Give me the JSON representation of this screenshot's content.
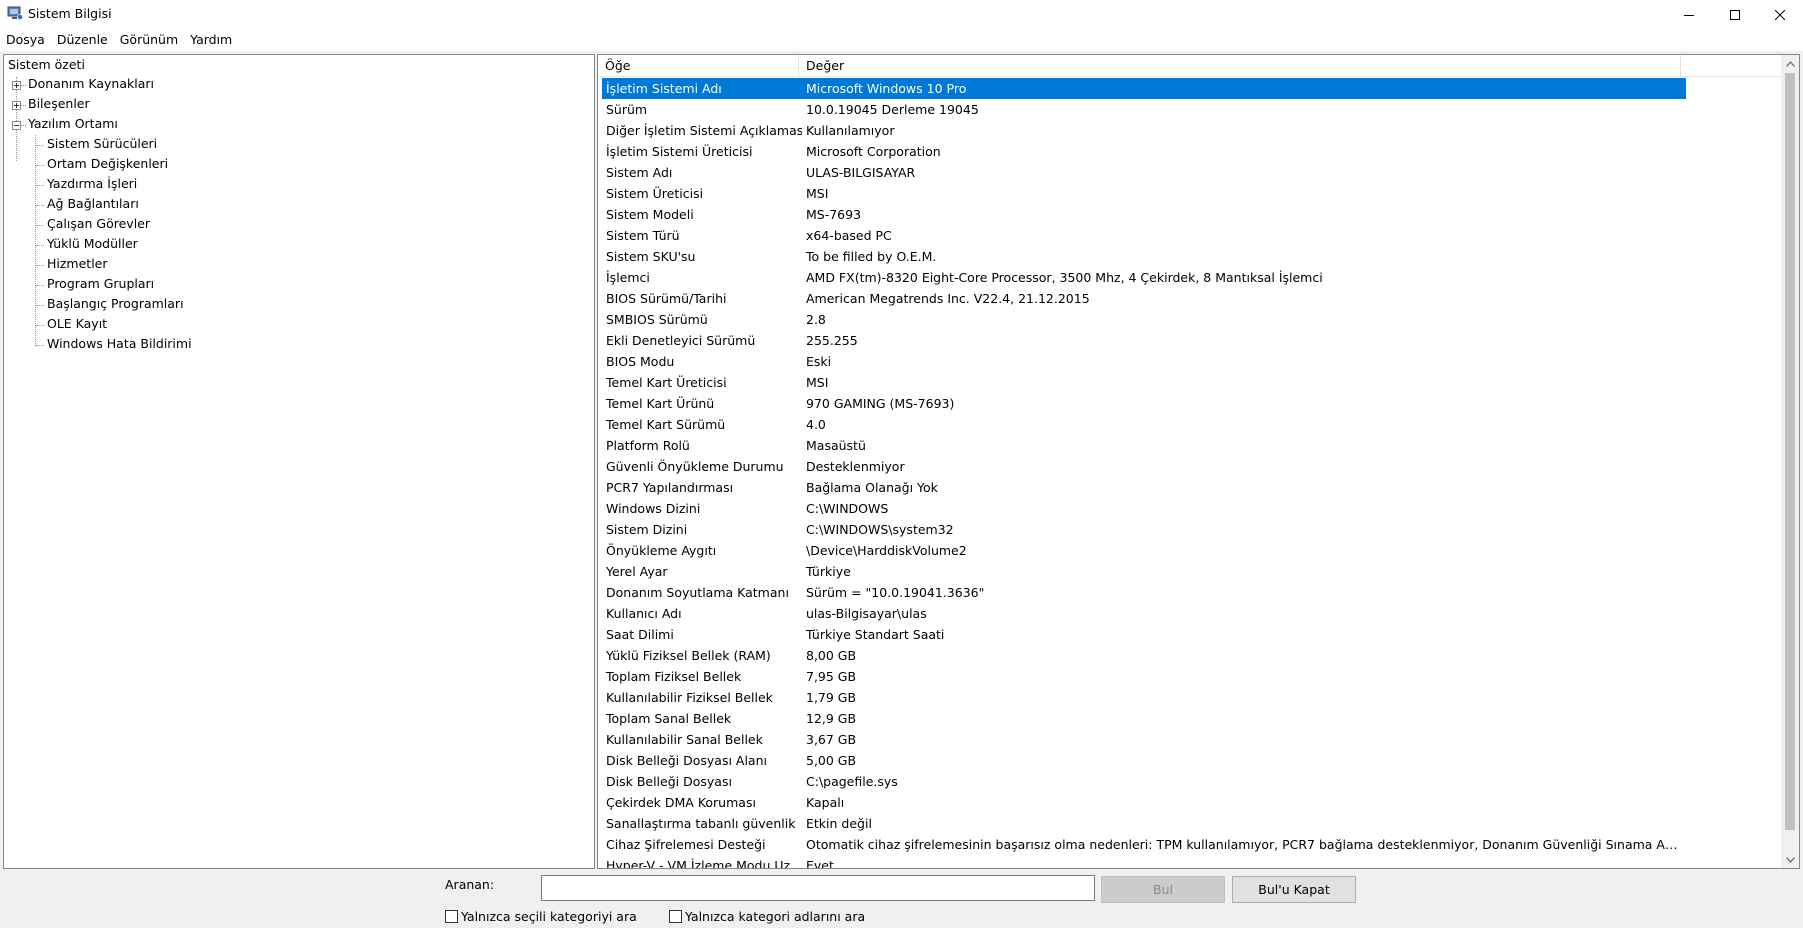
{
  "window": {
    "title": "Sistem Bilgisi",
    "app_icon": "system-info-icon"
  },
  "menu": [
    "Dosya",
    "Düzenle",
    "Görünüm",
    "Yardım"
  ],
  "tree": {
    "root": "Sistem özeti",
    "nodes": [
      {
        "label": "Donanım Kaynakları",
        "state": "collapsed"
      },
      {
        "label": "Bileşenler",
        "state": "collapsed"
      },
      {
        "label": "Yazılım Ortamı",
        "state": "expanded"
      }
    ],
    "software_children": [
      "Sistem Sürücüleri",
      "Ortam Değişkenleri",
      "Yazdırma İşleri",
      "Ağ Bağlantıları",
      "Çalışan Görevler",
      "Yüklü Modüller",
      "Hizmetler",
      "Program Grupları",
      "Başlangıç Programları",
      "OLE Kayıt",
      "Windows Hata Bildirimi"
    ]
  },
  "list": {
    "headers": [
      "Öğe",
      "Değer"
    ],
    "selected_index": 0,
    "rows": [
      [
        "İşletim Sistemi Adı",
        "Microsoft Windows 10 Pro"
      ],
      [
        "Sürüm",
        "10.0.19045 Derleme 19045"
      ],
      [
        "Diğer İşletim Sistemi Açıklaması",
        "Kullanılamıyor"
      ],
      [
        "İşletim Sistemi Üreticisi",
        "Microsoft Corporation"
      ],
      [
        "Sistem Adı",
        "ULAS-BILGISAYAR"
      ],
      [
        "Sistem Üreticisi",
        "MSI"
      ],
      [
        "Sistem Modeli",
        "MS-7693"
      ],
      [
        "Sistem Türü",
        "x64-based PC"
      ],
      [
        "Sistem SKU'su",
        "To be filled by O.E.M."
      ],
      [
        "İşlemci",
        "AMD FX(tm)-8320 Eight-Core Processor, 3500 Mhz, 4 Çekirdek, 8 Mantıksal İşlemci"
      ],
      [
        "BIOS Sürümü/Tarihi",
        "American Megatrends Inc. V22.4, 21.12.2015"
      ],
      [
        "SMBIOS Sürümü",
        "2.8"
      ],
      [
        "Ekli Denetleyici Sürümü",
        "255.255"
      ],
      [
        "BIOS Modu",
        "Eski"
      ],
      [
        "Temel Kart Üreticisi",
        "MSI"
      ],
      [
        "Temel Kart Ürünü",
        "970 GAMING (MS-7693)"
      ],
      [
        "Temel Kart Sürümü",
        "4.0"
      ],
      [
        "Platform Rolü",
        "Masaüstü"
      ],
      [
        "Güvenli Önyükleme Durumu",
        "Desteklenmiyor"
      ],
      [
        "PCR7 Yapılandırması",
        "Bağlama Olanağı Yok"
      ],
      [
        "Windows Dizini",
        "C:\\WINDOWS"
      ],
      [
        "Sistem Dizini",
        "C:\\WINDOWS\\system32"
      ],
      [
        "Önyükleme Aygıtı",
        "\\Device\\HarddiskVolume2"
      ],
      [
        "Yerel Ayar",
        "Türkiye"
      ],
      [
        "Donanım Soyutlama Katmanı",
        "Sürüm = \"10.0.19041.3636\""
      ],
      [
        "Kullanıcı Adı",
        "ulas-Bilgisayar\\ulas"
      ],
      [
        "Saat Dilimi",
        "Türkiye Standart Saati"
      ],
      [
        "Yüklü Fiziksel Bellek (RAM)",
        "8,00 GB"
      ],
      [
        "Toplam Fiziksel Bellek",
        "7,95 GB"
      ],
      [
        "Kullanılabilir Fiziksel Bellek",
        "1,79 GB"
      ],
      [
        "Toplam Sanal Bellek",
        "12,9 GB"
      ],
      [
        "Kullanılabilir Sanal Bellek",
        "3,67 GB"
      ],
      [
        "Disk Belleği Dosyası Alanı",
        "5,00 GB"
      ],
      [
        "Disk Belleği Dosyası",
        "C:\\pagefile.sys"
      ],
      [
        "Çekirdek DMA Koruması",
        "Kapalı"
      ],
      [
        "Sanallaştırma tabanlı güvenlik",
        "Etkin değil"
      ],
      [
        "Cihaz Şifrelemesi Desteği",
        "Otomatik cihaz şifrelemesinin başarısız olma nedenleri: TPM kullanılamıyor, PCR7 bağlama desteklenmiyor, Donanım Güvenliği Sınama Arabirimi baş..."
      ],
      [
        "Hyper-V - VM İzleme Modu Uz...",
        "Evet"
      ]
    ]
  },
  "search": {
    "label": "Aranan:",
    "value": "",
    "find_button": "Bul",
    "close_find_button": "Bul'u Kapat",
    "option_selected_category": "Yalnızca seçili kategoriyi ara",
    "option_category_names": "Yalnızca kategori adlarını ara"
  }
}
